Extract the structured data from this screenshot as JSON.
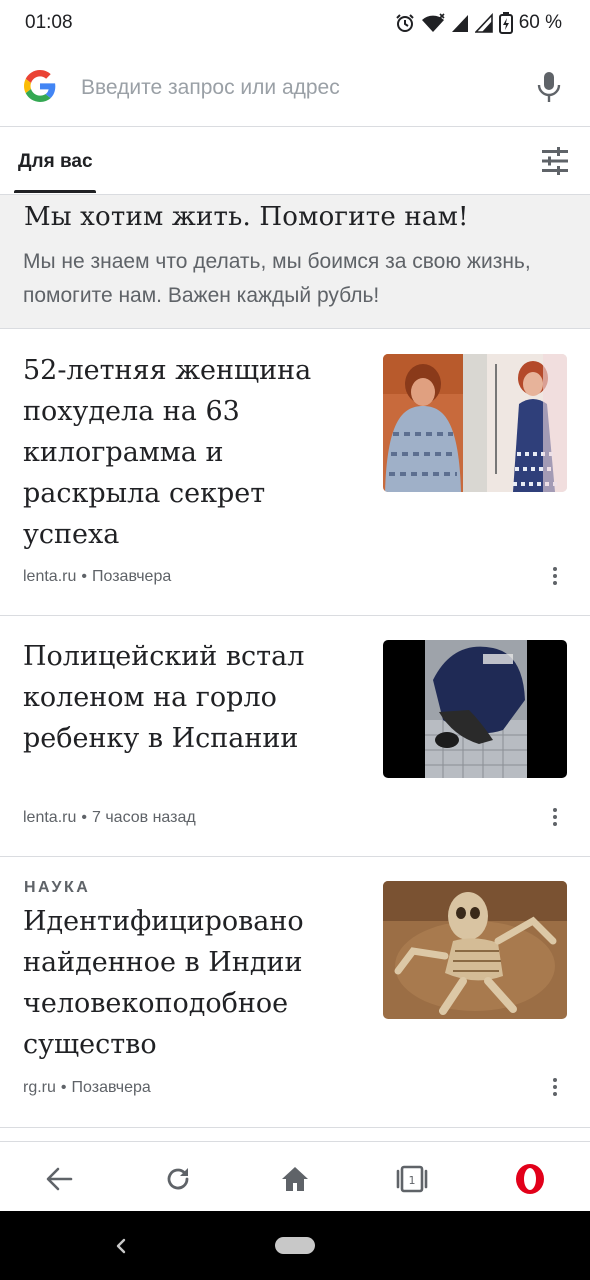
{
  "status_bar": {
    "time": "01:08",
    "battery_percent": "60 %",
    "icons": [
      "alarm-icon",
      "wifi-icon",
      "signal-icon",
      "signal-icon",
      "battery-icon"
    ]
  },
  "search": {
    "placeholder": "Введите запрос или адрес",
    "value": ""
  },
  "tabs": {
    "active_label": "Для вас"
  },
  "promo": {
    "title": "Мы хотим жить. Помогите нам!",
    "text": "Мы не знаем что делать, мы боимся за свою жизнь, помогите нам. Важен каждый рубль!"
  },
  "articles": [
    {
      "category": "",
      "title": "52-летняя женщина похудела на 63 килограмма и раскрыла секрет успеха",
      "source": "lenta.ru",
      "time": "Позавчера",
      "thumb": "weight-loss-photo"
    },
    {
      "category": "",
      "title": "Полицейский встал коленом на горло ребенку в Испании",
      "source": "lenta.ru",
      "time": "7 часов назад",
      "thumb": "police-photo"
    },
    {
      "category": "НАУКА",
      "title": "Идентифицировано найденное в Индии человекоподобное существо",
      "source": "rg.ru",
      "time": "Позавчера",
      "thumb": "skeleton-photo"
    }
  ],
  "bottom_nav": {
    "tab_count": "1",
    "items": [
      "back-icon",
      "reload-icon",
      "home-icon",
      "tabs-icon",
      "opera-icon"
    ]
  },
  "colors": {
    "opera_red": "#e2001a",
    "promo_bg": "#f1f1f1",
    "text_primary": "#202124",
    "text_secondary": "#5f6368"
  }
}
